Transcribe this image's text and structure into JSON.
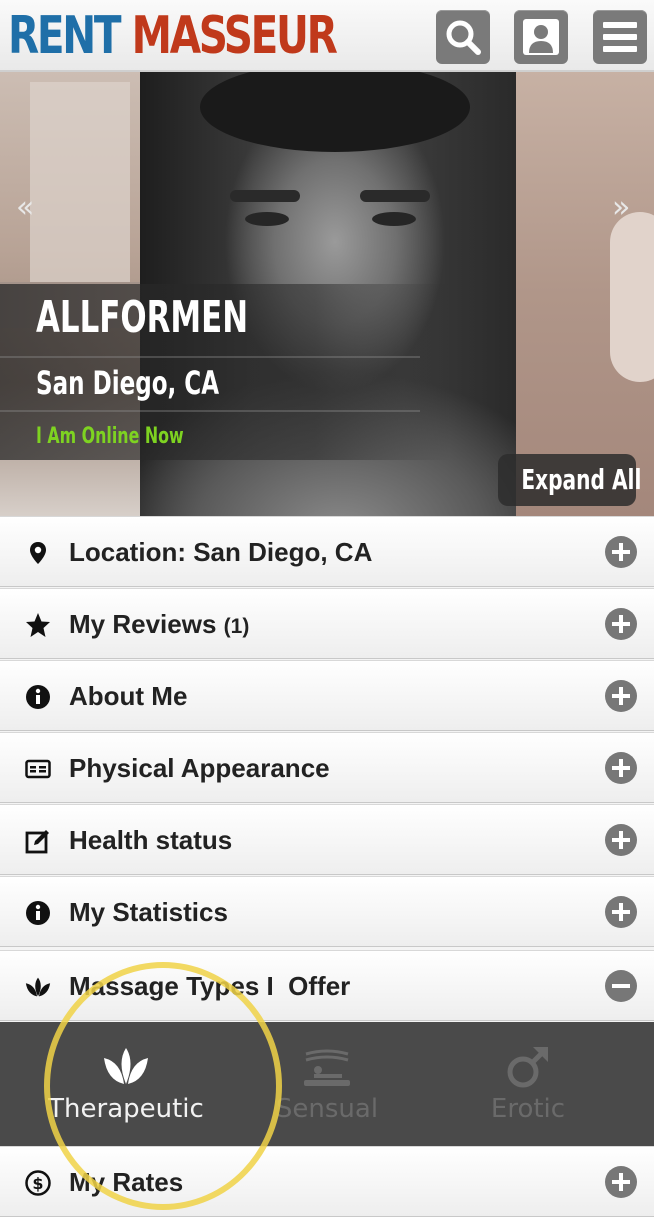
{
  "header": {
    "logo_word1": "RENT",
    "logo_word2": "MASSEUR",
    "buttons": [
      {
        "icon": "search-icon"
      },
      {
        "icon": "user-icon"
      },
      {
        "icon": "menu-icon"
      }
    ]
  },
  "hero": {
    "name": "ALLFORMEN",
    "city": "San Diego, CA",
    "online_status": "I Am Online Now",
    "prev_arrow": "«",
    "next_arrow": "»",
    "expand_label": "Expand All"
  },
  "sections": [
    {
      "icon": "location-pin-icon",
      "label": "Location: San Diego, CA",
      "count": "",
      "state": "collapsed"
    },
    {
      "icon": "star-icon",
      "label": "My Reviews",
      "count": "(1)",
      "state": "collapsed"
    },
    {
      "icon": "info-icon",
      "label": "About Me",
      "count": "",
      "state": "collapsed"
    },
    {
      "icon": "id-card-icon",
      "label": "Physical Appearance",
      "count": "",
      "state": "collapsed"
    },
    {
      "icon": "edit-icon",
      "label": "Health status",
      "count": "",
      "state": "collapsed"
    },
    {
      "icon": "info-icon",
      "label": "My Statistics",
      "count": "",
      "state": "collapsed"
    },
    {
      "icon": "lotus-icon",
      "label": "Massage Types I  Offer",
      "count": "",
      "state": "expanded"
    },
    {
      "icon": "dollar-icon",
      "label": "My Rates",
      "count": "",
      "state": "collapsed"
    }
  ],
  "massage_types": [
    {
      "label": "Therapeutic",
      "icon": "lotus-icon",
      "active": true
    },
    {
      "label": "Sensual",
      "icon": "massage-table-icon",
      "active": false
    },
    {
      "label": "Erotic",
      "icon": "male-symbol-icon",
      "active": false
    }
  ],
  "colors": {
    "logo_blue": "#1f6fa8",
    "logo_red": "#c0391b",
    "online_green": "#7ed321",
    "highlight_yellow": "#f0d246"
  }
}
